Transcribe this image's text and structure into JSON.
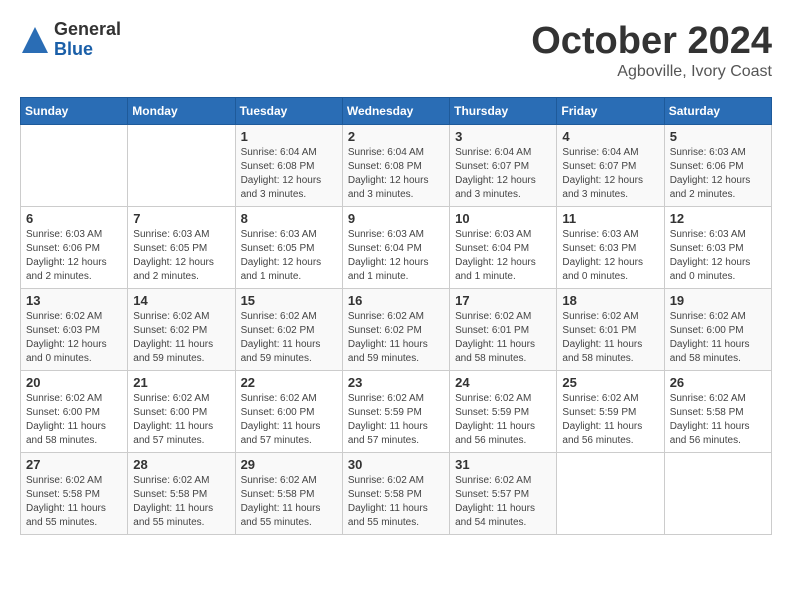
{
  "header": {
    "logo_general": "General",
    "logo_blue": "Blue",
    "month_title": "October 2024",
    "location": "Agboville, Ivory Coast"
  },
  "days_of_week": [
    "Sunday",
    "Monday",
    "Tuesday",
    "Wednesday",
    "Thursday",
    "Friday",
    "Saturday"
  ],
  "weeks": [
    [
      {
        "day": "",
        "info": ""
      },
      {
        "day": "",
        "info": ""
      },
      {
        "day": "1",
        "info": "Sunrise: 6:04 AM\nSunset: 6:08 PM\nDaylight: 12 hours and 3 minutes."
      },
      {
        "day": "2",
        "info": "Sunrise: 6:04 AM\nSunset: 6:08 PM\nDaylight: 12 hours and 3 minutes."
      },
      {
        "day": "3",
        "info": "Sunrise: 6:04 AM\nSunset: 6:07 PM\nDaylight: 12 hours and 3 minutes."
      },
      {
        "day": "4",
        "info": "Sunrise: 6:04 AM\nSunset: 6:07 PM\nDaylight: 12 hours and 3 minutes."
      },
      {
        "day": "5",
        "info": "Sunrise: 6:03 AM\nSunset: 6:06 PM\nDaylight: 12 hours and 2 minutes."
      }
    ],
    [
      {
        "day": "6",
        "info": "Sunrise: 6:03 AM\nSunset: 6:06 PM\nDaylight: 12 hours and 2 minutes."
      },
      {
        "day": "7",
        "info": "Sunrise: 6:03 AM\nSunset: 6:05 PM\nDaylight: 12 hours and 2 minutes."
      },
      {
        "day": "8",
        "info": "Sunrise: 6:03 AM\nSunset: 6:05 PM\nDaylight: 12 hours and 1 minute."
      },
      {
        "day": "9",
        "info": "Sunrise: 6:03 AM\nSunset: 6:04 PM\nDaylight: 12 hours and 1 minute."
      },
      {
        "day": "10",
        "info": "Sunrise: 6:03 AM\nSunset: 6:04 PM\nDaylight: 12 hours and 1 minute."
      },
      {
        "day": "11",
        "info": "Sunrise: 6:03 AM\nSunset: 6:03 PM\nDaylight: 12 hours and 0 minutes."
      },
      {
        "day": "12",
        "info": "Sunrise: 6:03 AM\nSunset: 6:03 PM\nDaylight: 12 hours and 0 minutes."
      }
    ],
    [
      {
        "day": "13",
        "info": "Sunrise: 6:02 AM\nSunset: 6:03 PM\nDaylight: 12 hours and 0 minutes."
      },
      {
        "day": "14",
        "info": "Sunrise: 6:02 AM\nSunset: 6:02 PM\nDaylight: 11 hours and 59 minutes."
      },
      {
        "day": "15",
        "info": "Sunrise: 6:02 AM\nSunset: 6:02 PM\nDaylight: 11 hours and 59 minutes."
      },
      {
        "day": "16",
        "info": "Sunrise: 6:02 AM\nSunset: 6:02 PM\nDaylight: 11 hours and 59 minutes."
      },
      {
        "day": "17",
        "info": "Sunrise: 6:02 AM\nSunset: 6:01 PM\nDaylight: 11 hours and 58 minutes."
      },
      {
        "day": "18",
        "info": "Sunrise: 6:02 AM\nSunset: 6:01 PM\nDaylight: 11 hours and 58 minutes."
      },
      {
        "day": "19",
        "info": "Sunrise: 6:02 AM\nSunset: 6:00 PM\nDaylight: 11 hours and 58 minutes."
      }
    ],
    [
      {
        "day": "20",
        "info": "Sunrise: 6:02 AM\nSunset: 6:00 PM\nDaylight: 11 hours and 58 minutes."
      },
      {
        "day": "21",
        "info": "Sunrise: 6:02 AM\nSunset: 6:00 PM\nDaylight: 11 hours and 57 minutes."
      },
      {
        "day": "22",
        "info": "Sunrise: 6:02 AM\nSunset: 6:00 PM\nDaylight: 11 hours and 57 minutes."
      },
      {
        "day": "23",
        "info": "Sunrise: 6:02 AM\nSunset: 5:59 PM\nDaylight: 11 hours and 57 minutes."
      },
      {
        "day": "24",
        "info": "Sunrise: 6:02 AM\nSunset: 5:59 PM\nDaylight: 11 hours and 56 minutes."
      },
      {
        "day": "25",
        "info": "Sunrise: 6:02 AM\nSunset: 5:59 PM\nDaylight: 11 hours and 56 minutes."
      },
      {
        "day": "26",
        "info": "Sunrise: 6:02 AM\nSunset: 5:58 PM\nDaylight: 11 hours and 56 minutes."
      }
    ],
    [
      {
        "day": "27",
        "info": "Sunrise: 6:02 AM\nSunset: 5:58 PM\nDaylight: 11 hours and 55 minutes."
      },
      {
        "day": "28",
        "info": "Sunrise: 6:02 AM\nSunset: 5:58 PM\nDaylight: 11 hours and 55 minutes."
      },
      {
        "day": "29",
        "info": "Sunrise: 6:02 AM\nSunset: 5:58 PM\nDaylight: 11 hours and 55 minutes."
      },
      {
        "day": "30",
        "info": "Sunrise: 6:02 AM\nSunset: 5:58 PM\nDaylight: 11 hours and 55 minutes."
      },
      {
        "day": "31",
        "info": "Sunrise: 6:02 AM\nSunset: 5:57 PM\nDaylight: 11 hours and 54 minutes."
      },
      {
        "day": "",
        "info": ""
      },
      {
        "day": "",
        "info": ""
      }
    ]
  ]
}
